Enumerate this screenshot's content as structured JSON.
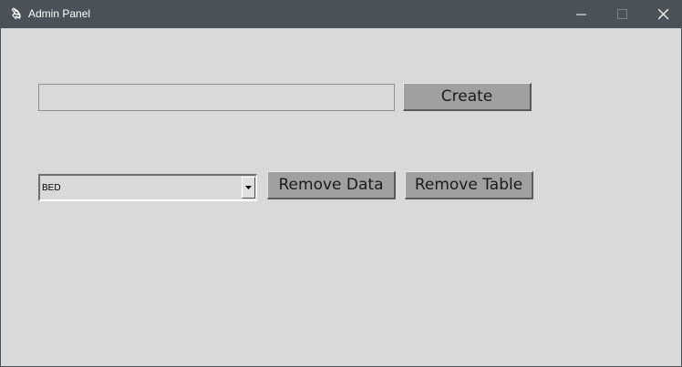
{
  "window": {
    "title": "Admin Panel",
    "app_icon": "feather-icon",
    "controls": [
      "minimize-icon",
      "maximize-icon",
      "close-icon"
    ]
  },
  "create_row": {
    "input_value": "",
    "button_label": "Create"
  },
  "remove_row": {
    "table_select_value": "BED",
    "remove_data_label": "Remove Data",
    "remove_table_label": "Remove Table"
  },
  "colors": {
    "titlebar": "#4a5157",
    "background": "#d9d9d9",
    "button": "#a0a0a0"
  }
}
